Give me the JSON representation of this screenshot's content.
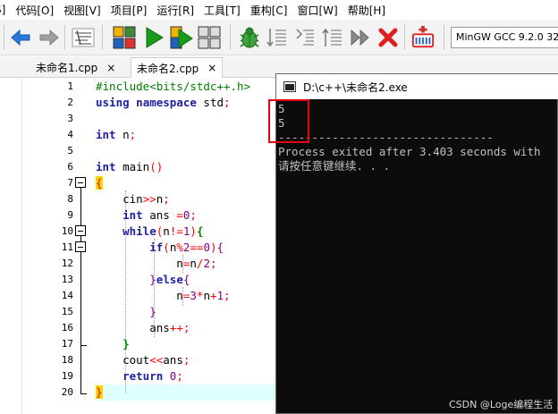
{
  "menu": [
    "S]",
    "代码[O]",
    "视图[V]",
    "项目[P]",
    "运行[R]",
    "工具[T]",
    "重构[C]",
    "窗口[W]",
    "帮助[H]"
  ],
  "toolbar": {
    "icons": [
      "back-arrow-icon",
      "forward-arrow-icon",
      "format-icon",
      "compile-icon",
      "run-icon",
      "compile-run-icon",
      "rebuild-icon",
      "debug-icon",
      "step-into-icon",
      "step-over-icon",
      "step-out-icon",
      "continue-icon",
      "stop-icon",
      "profile-icon"
    ],
    "compiler": "MinGW GCC 9.2.0 32-"
  },
  "tabs": [
    {
      "label": "未命名1.cpp",
      "close": "×",
      "active": false
    },
    {
      "label": "未命名2.cpp",
      "close": "×",
      "active": true
    }
  ],
  "editor": {
    "line_numbers": [
      "1",
      "2",
      "3",
      "4",
      "5",
      "6",
      "7",
      "8",
      "9",
      "10",
      "11",
      "12",
      "13",
      "14",
      "15",
      "16",
      "17",
      "18",
      "19",
      "20"
    ],
    "current_line": 20
  },
  "console": {
    "title": "D:\\c++\\未命名2.exe",
    "lines": [
      "5",
      "5",
      "--------------------------------",
      "Process exited after 3.403 seconds with",
      "请按任意键继续. . ."
    ]
  },
  "watermark": "CSDN @Loge编程生活",
  "colors": {
    "highlight_box": "#e60012",
    "current_line": "#e0ffff",
    "keyword": "#1f1f9f",
    "operator": "#ff0000",
    "number": "#800080",
    "preprocessor": "#008000"
  }
}
